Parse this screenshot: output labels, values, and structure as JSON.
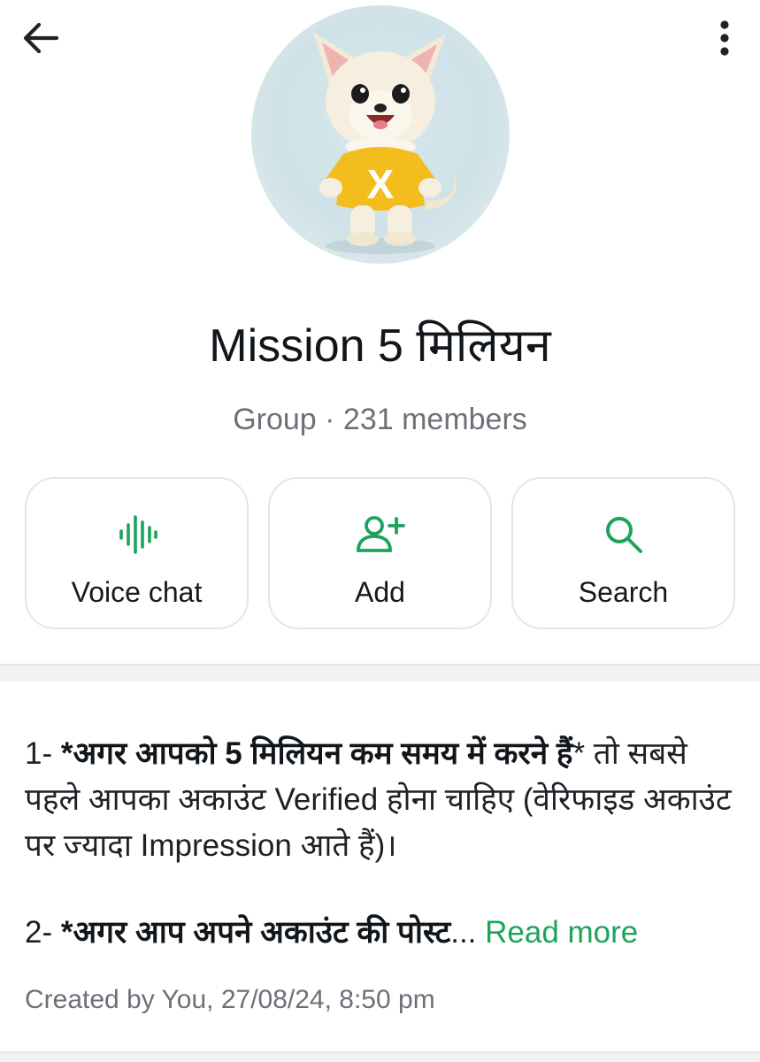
{
  "header": {
    "back_icon": "arrow-left-icon",
    "menu_icon": "more-vertical-icon"
  },
  "group": {
    "name": "Mission 5 मिलियन",
    "meta": "Group · 231 members",
    "avatar_icon": "puppy-mascot-avatar"
  },
  "actions": [
    {
      "label": "Voice chat",
      "icon": "voice-wave-icon"
    },
    {
      "label": "Add",
      "icon": "add-person-icon"
    },
    {
      "label": "Search",
      "icon": "search-icon"
    }
  ],
  "description": {
    "p1_prefix": "1- ",
    "p1_bold": "*अगर आपको 5 मिलियन कम समय में करने हैं",
    "p1_rest": "* तो सबसे पहले आपका अकाउंट Verified होना चाहिए (वेरिफाइड अकाउंट पर ज्यादा Impression आते हैं)।",
    "p2_prefix": "2- ",
    "p2_bold": "*अगर आप अपने अकाउंट की पोस्ट",
    "p2_ellipsis": "... ",
    "read_more": "Read more"
  },
  "created": "Created by You, 27/08/24, 8:50 pm",
  "colors": {
    "accent_green": "#1da35c",
    "text_primary": "#11161b",
    "text_secondary": "#6b7177",
    "card_border": "#e4e6e8"
  }
}
